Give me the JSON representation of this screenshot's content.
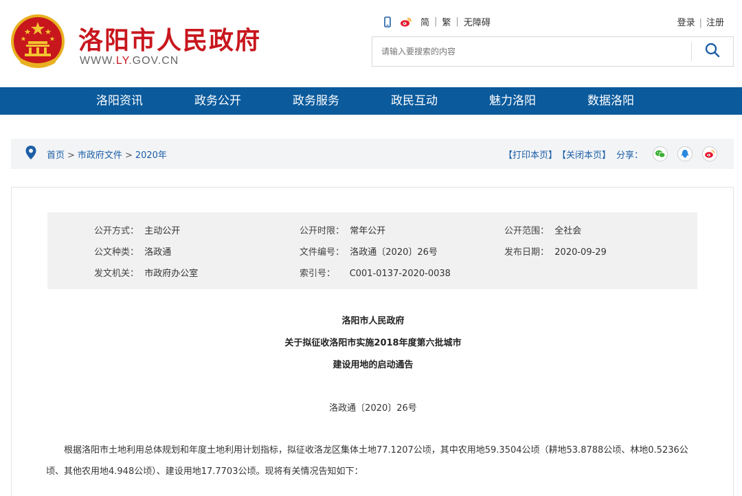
{
  "site": {
    "title": "洛阳市人民政府",
    "url_pre": "WWW.",
    "url_mid": "LY",
    "url_post": ".GOV.CN"
  },
  "tools": {
    "simplified": "简",
    "traditional": "繁",
    "accessible": "无障碍",
    "sep": "|"
  },
  "auth": {
    "login": "登录",
    "register": "注册",
    "sep": "|"
  },
  "search": {
    "placeholder": "请输入要搜索的内容"
  },
  "nav": [
    "洛阳资讯",
    "政务公开",
    "政务服务",
    "政民互动",
    "魅力洛阳",
    "数据洛阳"
  ],
  "breadcrumb": {
    "home": "首页",
    "files": "市政府文件",
    "year": "2020年",
    "gt": ">"
  },
  "actions": {
    "print": "【打印本页】",
    "close": "【关闭本页】",
    "share": "分享："
  },
  "meta": {
    "r1": [
      {
        "k": "公开方式：",
        "v": "主动公开"
      },
      {
        "k": "公开时限：",
        "v": "常年公开"
      },
      {
        "k": "公开范围：",
        "v": "全社会"
      }
    ],
    "r2": [
      {
        "k": "公文种类：",
        "v": "洛政通"
      },
      {
        "k": "文件编号：",
        "v": "洛政通〔2020〕26号"
      },
      {
        "k": "发布日期：",
        "v": "2020-09-29"
      }
    ],
    "r3": [
      {
        "k": "发文机关：",
        "v": "市政府办公室"
      },
      {
        "k": "索引号：",
        "v": "C001-0137-2020-0038"
      }
    ]
  },
  "document": {
    "issuer": "洛阳市人民政府",
    "title_line1": "关于拟征收洛阳市实施2018年度第六批城市",
    "title_line2": "建设用地的启动通告",
    "number": "洛政通〔2020〕26号",
    "paragraph1": "根据洛阳市土地利用总体规划和年度土地利用计划指标，拟征收洛龙区集体土地77.1207公顷，其中农用地59.3504公顷（耕地53.8788公顷、林地0.5236公顷、其他农用地4.948公顷）、建设用地17.7703公顷。现将有关情况告知如下："
  },
  "colors": {
    "brand_red": "#c8161d",
    "nav_blue": "#0a5a9c",
    "link_blue": "#1c5ea6"
  }
}
